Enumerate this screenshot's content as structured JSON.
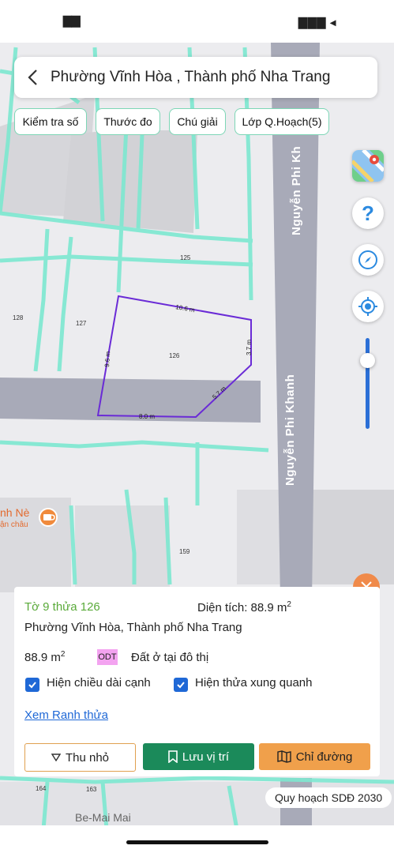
{
  "status": {
    "left": "▇▇",
    "right": "▇▇▇ ◂"
  },
  "search": {
    "title": "Phường Vĩnh Hòa , Thành phố Nha Trang"
  },
  "toolbar": {
    "check": "Kiểm tra số",
    "ruler": "Thước đo",
    "legend": "Chú giải",
    "layer": "Lớp Q.Hoạch(5)"
  },
  "map": {
    "streets": {
      "main": "Nguyễn Phi Khanh",
      "top": "Nguyễn Phi Kh",
      "bottom": "Be-Mai Mai"
    },
    "poi": {
      "name": "nh Nè",
      "sub": "ận châu"
    },
    "parcels": {
      "p125": "125",
      "p126": "126",
      "p127": "127",
      "p128": "128",
      "p159": "159",
      "p164": "164",
      "p163": "163"
    },
    "edges": {
      "top": "10.6 m",
      "right": "3.7 m",
      "diag": "5.7 m",
      "bottom": "8.0 m",
      "left": "9.6 m"
    }
  },
  "controls": {
    "help": "?"
  },
  "panel": {
    "parcel_id": "Tờ 9 thửa 126",
    "area_label": "Diện tích: 88.9 m",
    "area_sup": "2",
    "address": "Phường Vĩnh Hòa, Thành phố Nha Trang",
    "land_area": "88.9 m",
    "land_sup": "2",
    "land_code": "ODT",
    "land_type": "Đất ở tại đô thị",
    "show_edges": "Hiện chiều dài cạnh",
    "show_neighbors": "Hiện thửa xung quanh",
    "view_boundary": "Xem Ranh thửa",
    "collapse": "Thu nhỏ",
    "save": "Lưu vị trí",
    "directions": "Chỉ đường"
  },
  "plan_badge": "Quy hoạch SDĐ 2030",
  "colors": {
    "accent_green": "#1b8a5a",
    "accent_orange": "#f0a04b",
    "parcel_outline": "#6a2bd6",
    "plot_lines": "#7de8d0"
  }
}
